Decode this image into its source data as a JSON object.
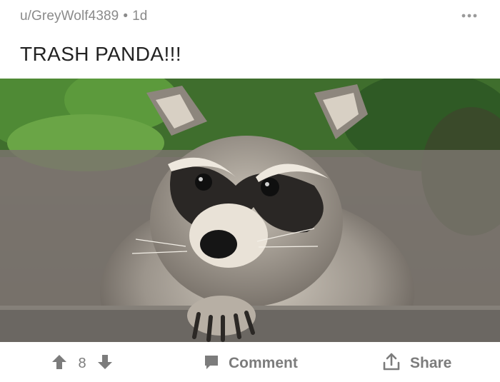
{
  "post": {
    "author": "u/GreyWolf4389",
    "separator": "•",
    "age": "1d",
    "title": "TRASH PANDA!!!",
    "image": {
      "subject": "raccoon-photo"
    }
  },
  "actions": {
    "score": "8",
    "comment_label": "Comment",
    "share_label": "Share"
  },
  "icons": {
    "more": "more-options-icon",
    "upvote": "upvote-arrow-icon",
    "downvote": "downvote-arrow-icon",
    "comment": "comment-bubble-icon",
    "share": "share-upload-icon"
  },
  "colors": {
    "meta_text": "#8a8a8a",
    "title_text": "#222222",
    "action_icon": "#7c7c7c"
  }
}
